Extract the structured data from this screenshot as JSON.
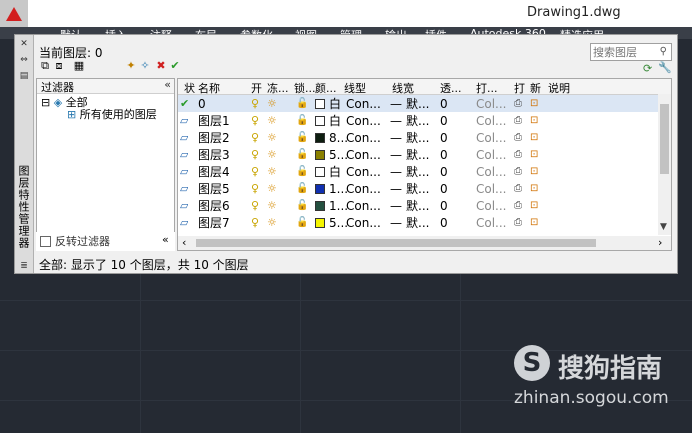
{
  "window": {
    "title": "Drawing1.dwg"
  },
  "ribbon": {
    "tabs": [
      "默认",
      "插入",
      "注释",
      "布局",
      "参数化",
      "视图",
      "管理",
      "输出",
      "插件",
      "Autodesk 360",
      "精选应用"
    ]
  },
  "palette": {
    "side_title": "图层特性管理器",
    "current_layer": "当前图层: 0",
    "search_placeholder": "搜索图层",
    "filter_header": "过滤器",
    "tree_root": "全部",
    "tree_child": "所有使用的图层",
    "invert_filter": "反转过滤器",
    "collapse": "«",
    "status": "全部: 显示了 10 个图层，共 10 个图层"
  },
  "columns": [
    "状",
    "名称",
    "开",
    "冻...",
    "锁...",
    "颜...",
    "线型",
    "线宽",
    "透...",
    "打...",
    "打",
    "新",
    "说明"
  ],
  "layers": [
    {
      "name": "0",
      "color": "白",
      "swatch": "#ffffff",
      "linetype": "Con...",
      "lineweight": "默...",
      "transparency": "0",
      "plotstyle": "Col...",
      "current": true
    },
    {
      "name": "图层1",
      "color": "白",
      "swatch": "#ffffff",
      "linetype": "Con...",
      "lineweight": "默...",
      "transparency": "0",
      "plotstyle": "Col..."
    },
    {
      "name": "图层2",
      "color": "8...",
      "swatch": "#0e1e10",
      "linetype": "Con...",
      "lineweight": "默...",
      "transparency": "0",
      "plotstyle": "Col..."
    },
    {
      "name": "图层3",
      "color": "5...",
      "swatch": "#8a8000",
      "linetype": "Con...",
      "lineweight": "默...",
      "transparency": "0",
      "plotstyle": "Col..."
    },
    {
      "name": "图层4",
      "color": "白",
      "swatch": "#ffffff",
      "linetype": "Con...",
      "lineweight": "默...",
      "transparency": "0",
      "plotstyle": "Col..."
    },
    {
      "name": "图层5",
      "color": "1...",
      "swatch": "#1030b0",
      "linetype": "Con...",
      "lineweight": "默...",
      "transparency": "0",
      "plotstyle": "Col..."
    },
    {
      "name": "图层6",
      "color": "1...",
      "swatch": "#245040",
      "linetype": "Con...",
      "lineweight": "默...",
      "transparency": "0",
      "plotstyle": "Col..."
    },
    {
      "name": "图层7",
      "color": "5...",
      "swatch": "#f5f500",
      "linetype": "Con...",
      "lineweight": "默...",
      "transparency": "0",
      "plotstyle": "Col..."
    }
  ],
  "watermark": {
    "logo": "S",
    "name": "搜狗指南",
    "url": "zhinan.sogou.com"
  }
}
